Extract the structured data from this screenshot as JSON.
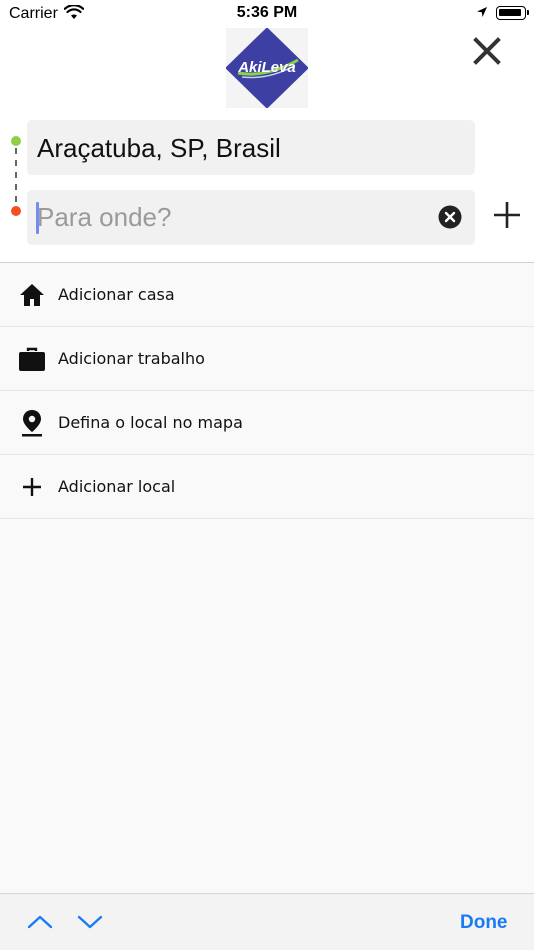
{
  "status_bar": {
    "carrier": "Carrier",
    "time": "5:36 PM"
  },
  "header": {
    "logo_text": "AkiLeva"
  },
  "route": {
    "origin": "Araçatuba, SP, Brasil",
    "destination_placeholder": "Para onde?",
    "origin_dot_color": "#8bd14a",
    "destination_dot_color": "#f4511e"
  },
  "shortcuts": [
    {
      "label": "Adicionar casa",
      "icon": "home-icon"
    },
    {
      "label": "Adicionar trabalho",
      "icon": "briefcase-icon"
    },
    {
      "label": "Defina o local no mapa",
      "icon": "map-pin-icon"
    },
    {
      "label": "Adicionar local",
      "icon": "plus-icon"
    }
  ],
  "keyboard_toolbar": {
    "done_label": "Done"
  },
  "colors": {
    "accent": "#1a7cf4",
    "logo_blue": "#3d3fa3",
    "logo_green": "#8bd14a"
  }
}
